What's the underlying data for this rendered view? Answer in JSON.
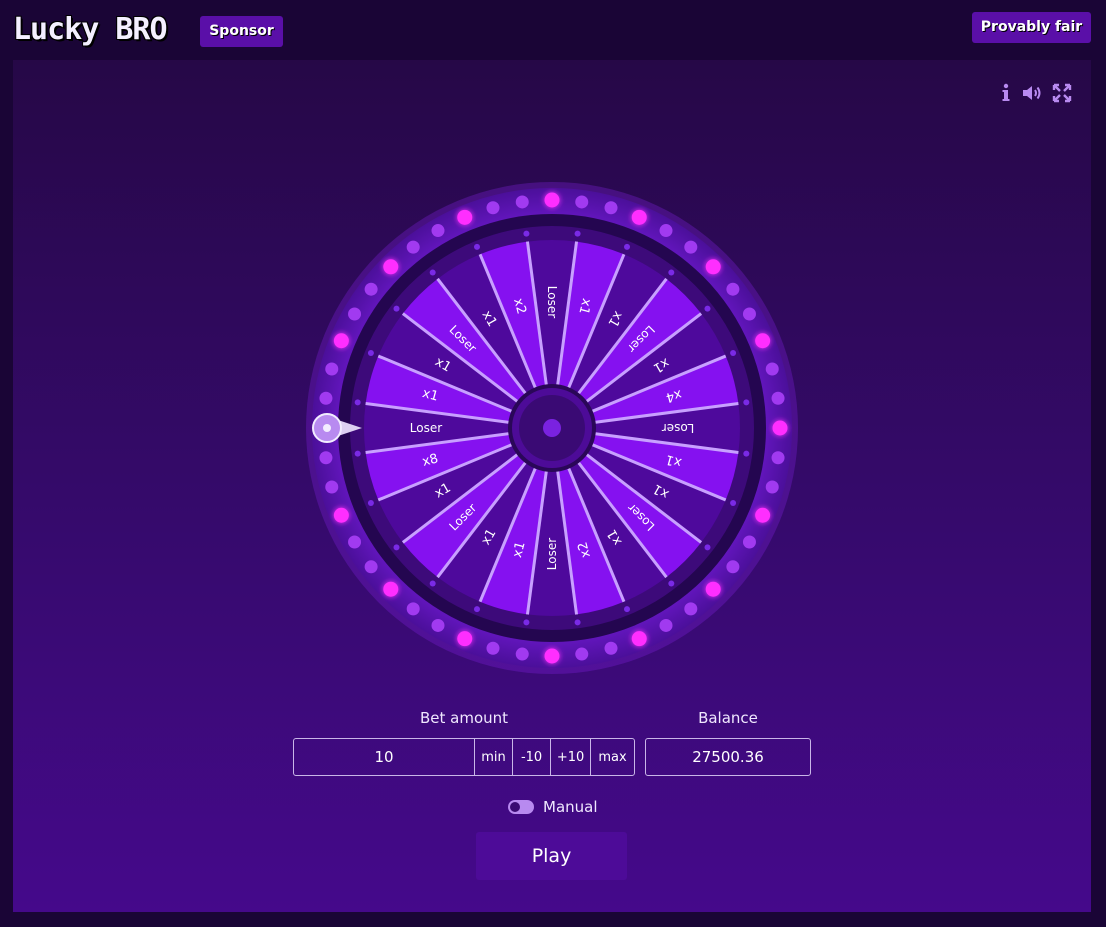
{
  "header": {
    "logo": "Lucky BRO",
    "sponsor_label": "Sponsor",
    "provably_fair_label": "Provably fair"
  },
  "toolbar": {
    "icons": [
      "info-icon",
      "volume-icon",
      "fullscreen-icon"
    ]
  },
  "wheel": {
    "segments": [
      "Loser",
      "x1",
      "x1",
      "Loser",
      "x1",
      "x2",
      "Loser",
      "x1",
      "x1",
      "Loser",
      "x1",
      "x4",
      "Loser",
      "x1",
      "x1",
      "Loser",
      "x1",
      "x2",
      "Loser",
      "x1",
      "x1",
      "Loser",
      "x1",
      "x8"
    ],
    "pointer_segment": "Loser",
    "colors": {
      "segment_light": "#8511f0",
      "segment_dark": "#4e099c",
      "rim": "#3d0a7a",
      "led_on": "#ff2dff",
      "led_off": "#a13af0",
      "spoke": "#c8a0ff"
    }
  },
  "bet": {
    "label": "Bet amount",
    "value": "10",
    "buttons": [
      "min",
      "-10",
      "+10",
      "max"
    ]
  },
  "balance": {
    "label": "Balance",
    "value": "27500.36"
  },
  "mode": {
    "label": "Manual",
    "autoplay_on": false
  },
  "play_label": "Play"
}
